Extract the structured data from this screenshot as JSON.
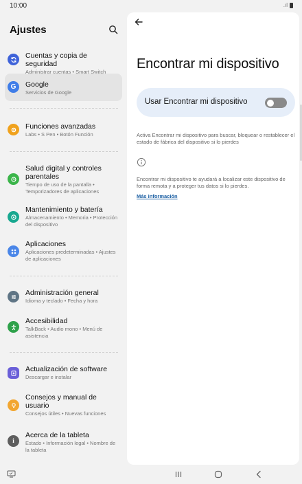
{
  "status_bar": {
    "time": "10:00"
  },
  "sidebar": {
    "title": "Ajustes",
    "items": [
      {
        "title": "Cuentas y copia de seguridad",
        "sub": "Administrar cuentas  •  Smart Switch",
        "color": "#3f63d9"
      },
      {
        "title": "Google",
        "sub": "Servicios de Google",
        "color": "#3f7de8"
      },
      {
        "title": "Funciones avanzadas",
        "sub": "Labs  •  S Pen  •  Botón Función",
        "color": "#f0a21d"
      },
      {
        "title": "Salud digital y controles parentales",
        "sub": "Tiempo de uso de la pantalla  •  Temporizadores de aplicaciones",
        "color": "#3bb54a"
      },
      {
        "title": "Mantenimiento y batería",
        "sub": "Almacenamiento  •  Memoria  •  Protección del dispositivo",
        "color": "#18a890"
      },
      {
        "title": "Aplicaciones",
        "sub": "Aplicaciones predeterminadas  •  Ajustes de aplicaciones",
        "color": "#4a86e8"
      },
      {
        "title": "Administración general",
        "sub": "Idioma y teclado  •  Fecha y hora",
        "color": "#5f7585"
      },
      {
        "title": "Accesibilidad",
        "sub": "TalkBack  •  Audio mono  •  Menú de asistencia",
        "color": "#2ea14a"
      },
      {
        "title": "Actualización de software",
        "sub": "Descargar e instalar",
        "color": "#6a5fd8"
      },
      {
        "title": "Consejos y manual de usuario",
        "sub": "Consejos útiles  •  Nuevas funciones",
        "color": "#f2a630"
      },
      {
        "title": "Acerca de la tableta",
        "sub": "Estado  •  Información legal  •  Nombre de la tableta",
        "color": "#5e5e5e"
      }
    ]
  },
  "detail": {
    "title": "Encontrar mi dispositivo",
    "toggle_label": "Usar Encontrar mi dispositivo",
    "toggle_on": false,
    "description": "Activa Encontrar mi dispositivo para buscar, bloquear o restablecer el estado de fábrica del dispositivo si lo pierdes",
    "info_text": "Encontrar mi dispositivo te ayudará a localizar este dispositivo de forma remota y a proteger tus datos si lo pierdes.",
    "more_link": "Más información"
  }
}
